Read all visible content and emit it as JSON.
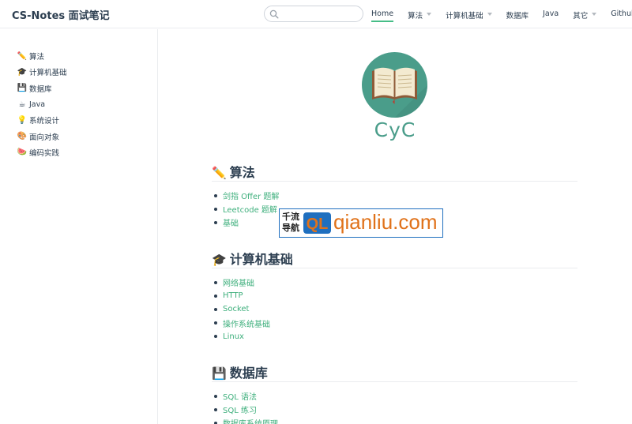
{
  "site": {
    "name": "CS-Notes 面试笔记"
  },
  "search": {
    "placeholder": "",
    "value": ""
  },
  "nav": {
    "items": [
      {
        "label": "Home",
        "active": true,
        "dropdown": false
      },
      {
        "label": "算法",
        "active": false,
        "dropdown": true
      },
      {
        "label": "计算机基础",
        "active": false,
        "dropdown": true
      },
      {
        "label": "数据库",
        "active": false,
        "dropdown": false
      },
      {
        "label": "Java",
        "active": false,
        "dropdown": false
      },
      {
        "label": "其它",
        "active": false,
        "dropdown": true
      },
      {
        "label": "Github",
        "active": false,
        "dropdown": false,
        "external": true
      }
    ]
  },
  "sidebar": {
    "items": [
      {
        "emoji": "✏️",
        "label": "算法"
      },
      {
        "emoji": "🎓",
        "label": "计算机基础"
      },
      {
        "emoji": "💾",
        "label": "数据库"
      },
      {
        "emoji": "☕",
        "label": "Java"
      },
      {
        "emoji": "💡",
        "label": "系统设计"
      },
      {
        "emoji": "🎨",
        "label": "面向对象"
      },
      {
        "emoji": "🍉",
        "label": "编码实践"
      }
    ]
  },
  "hero": {
    "title": "CyC",
    "logo_icon": "open-book-icon"
  },
  "sections": [
    {
      "emoji": "✏️",
      "title": "算法",
      "links": [
        "剑指 Offer 题解",
        "Leetcode 题解",
        "基础"
      ]
    },
    {
      "emoji": "🎓",
      "title": "计算机基础",
      "links": [
        "网络基础",
        "HTTP",
        "Socket",
        "操作系统基础",
        "Linux"
      ]
    },
    {
      "emoji": "💾",
      "title": "数据库",
      "links": [
        "SQL 语法",
        "SQL 练习",
        "数据库系统原理"
      ]
    }
  ],
  "watermark": {
    "cn_line1": "千流",
    "cn_line2": "导航",
    "badge": "QL",
    "text": "qianliu.com"
  },
  "colors": {
    "accent": "#3eaf7c",
    "text": "#2c3e50",
    "logo_bg": "#4a9d8a",
    "watermark_border": "#1f6fbf",
    "watermark_text": "#e0721a"
  }
}
